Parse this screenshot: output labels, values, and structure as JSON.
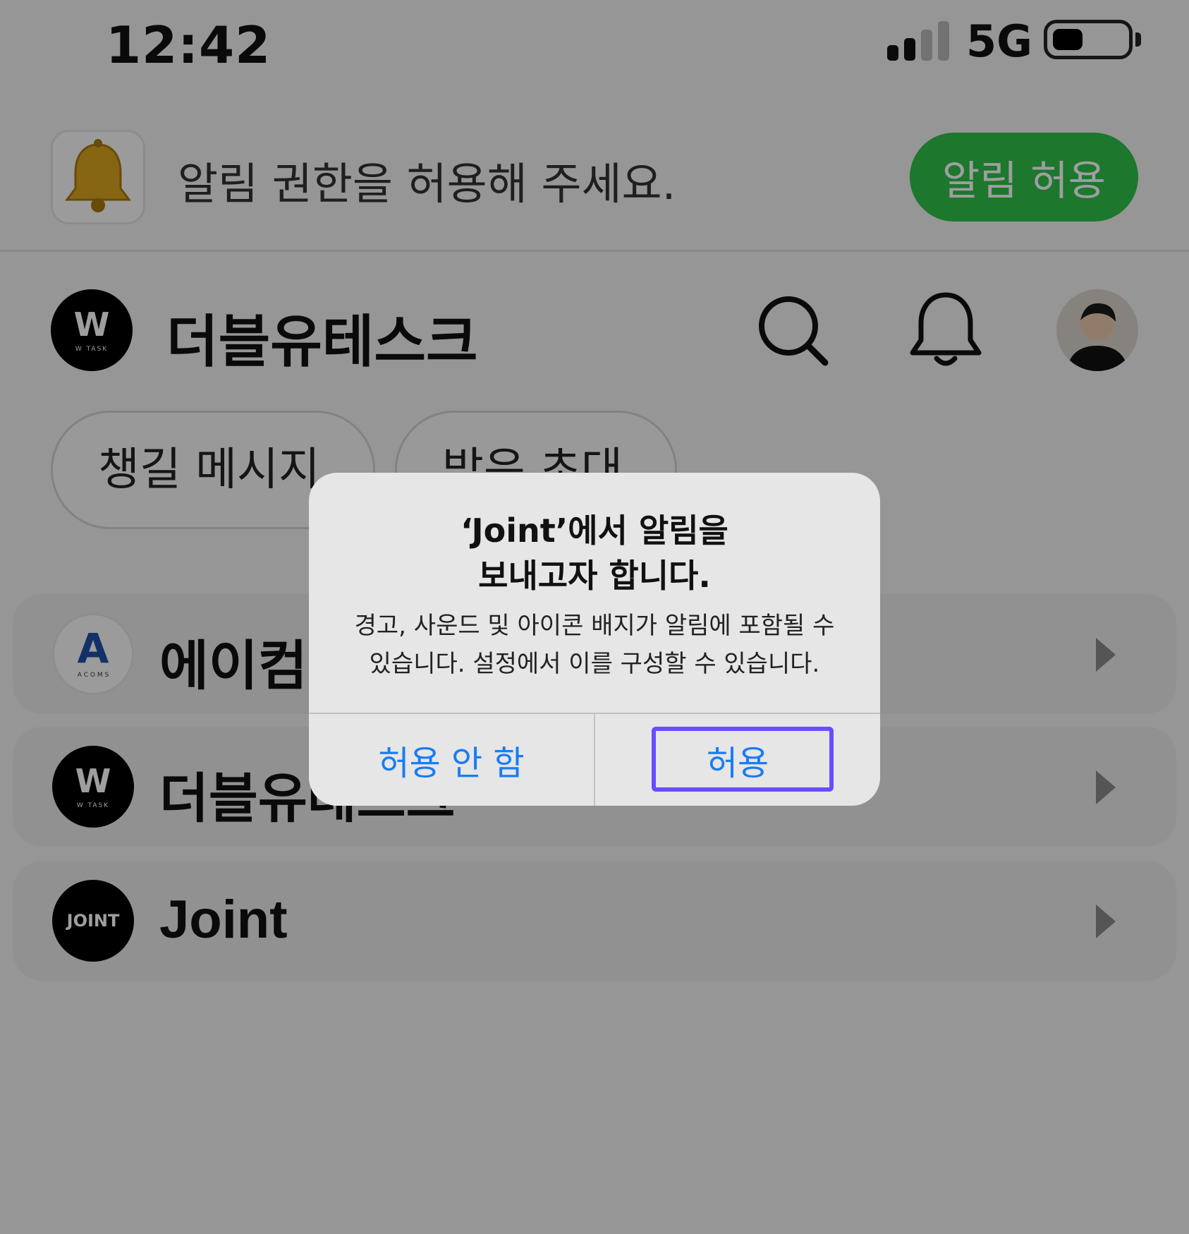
{
  "status_bar": {
    "time": "12:42",
    "network": "5G"
  },
  "banner": {
    "text": "알림 권한을 허용해 주세요.",
    "button": "알림 허용"
  },
  "header": {
    "brand": "더블유테스크",
    "logo_text": "W",
    "logo_subtext": "W TASK"
  },
  "tabs": [
    {
      "label": "챙길 메시지"
    },
    {
      "label": "받은 초대"
    }
  ],
  "workspaces": [
    {
      "label": "에이컴즈",
      "logo_text": "A",
      "logo_subtext": "A C O M S"
    },
    {
      "label": "더블유테스크",
      "logo_text": "W",
      "logo_subtext": "W TASK"
    },
    {
      "label": "Joint",
      "logo_text": "JOINT"
    }
  ],
  "dialog": {
    "title_line1": "‘Joint’에서 알림을",
    "title_line2": "보내고자 합니다.",
    "message_line1": "경고, 사운드 및 아이콘 배지가 알림에 포함될 수",
    "message_line2": "있습니다. 설정에서 이를 구성할 수 있습니다.",
    "deny_label": "허용 안 함",
    "allow_label": "허용"
  },
  "colors": {
    "accent_green": "#30c04a",
    "ios_blue": "#1a7cf2",
    "highlight": "#6a4cff"
  }
}
